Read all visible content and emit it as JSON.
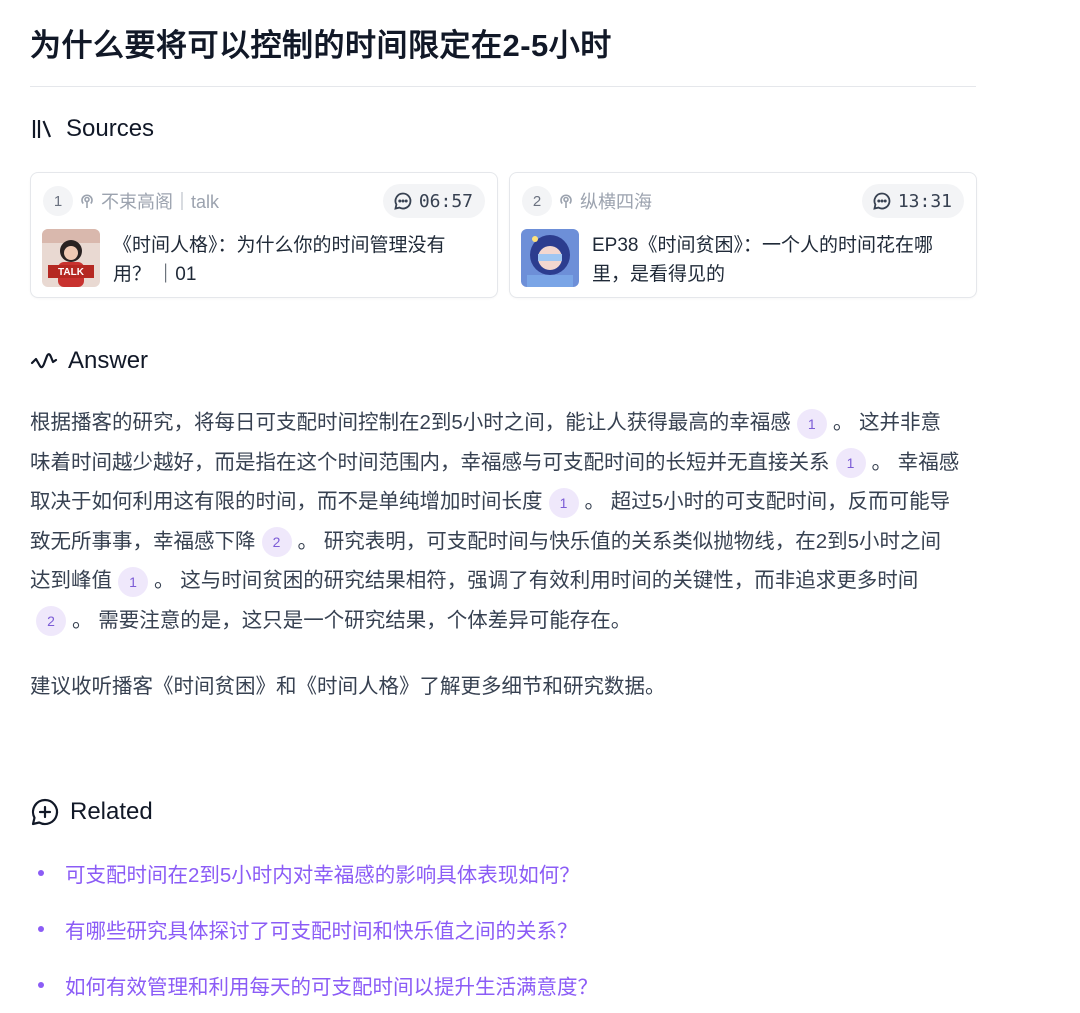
{
  "title": "为什么要将可以控制的时间限定在2-5小时",
  "sources": {
    "heading": "Sources",
    "cards": [
      {
        "index": "1",
        "podcast": "不束高阁｜talk",
        "time": "06:57",
        "episode": "《时间人格》：为什么你的时间管理没有用？ ｜01",
        "thumb_text": "TALK"
      },
      {
        "index": "2",
        "podcast": "纵横四海",
        "time": "13:31",
        "episode": "EP38《时间贫困》：一个人的时间花在哪里，是看得见的"
      }
    ]
  },
  "answer": {
    "heading": "Answer",
    "p1": [
      {
        "t": "根据播客的研究，将每日可支配时间控制在2到5小时之间，能让人获得最高的幸福感"
      },
      {
        "c": "1"
      },
      {
        "t": "。 这并非意味着时间越少越好，而是指在这个时间范围内，幸福感与可支配时间的长短并无直接关系"
      },
      {
        "c": "1"
      },
      {
        "t": "。 幸福感取决于如何利用这有限的时间，而不是单纯增加时间长度"
      },
      {
        "c": "1"
      },
      {
        "t": "。 超过5小时的可支配时间，反而可能导致无所事事，幸福感下降"
      },
      {
        "c": "2"
      },
      {
        "t": "。 研究表明，可支配时间与快乐值的关系类似抛物线，在2到5小时之间达到峰值"
      },
      {
        "c": "1"
      },
      {
        "t": "。 这与时间贫困的研究结果相符，强调了有效利用时间的关键性，而非追求更多时间"
      },
      {
        "c": "2"
      },
      {
        "t": "。 需要注意的是，这只是一个研究结果，个体差异可能存在。"
      }
    ],
    "p2": "建议收听播客《时间贫困》和《时间人格》了解更多细节和研究数据。"
  },
  "related": {
    "heading": "Related",
    "items": [
      "可支配时间在2到5小时内对幸福感的影响具体表现如何？",
      "有哪些研究具体探讨了可支配时间和快乐值之间的关系？",
      "如何有效管理和利用每天的可支配时间以提升生活满意度？"
    ]
  },
  "colors": {
    "accent": "#8b5cf6",
    "cite_bg": "#efe8fb",
    "cite_text": "#7c5cd6"
  }
}
